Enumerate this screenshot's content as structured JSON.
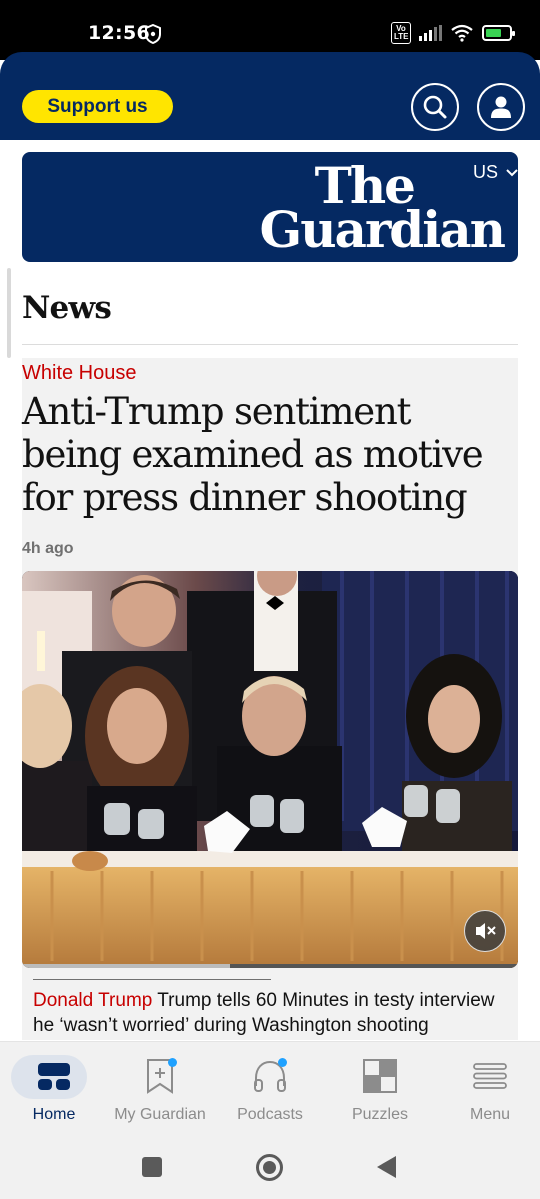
{
  "status_bar": {
    "time": "12:56",
    "volte_label": "Vo LTE",
    "battery_label": "6"
  },
  "header": {
    "support_label": "Support us",
    "search_icon": "search-icon",
    "profile_icon": "profile-icon"
  },
  "masthead": {
    "logo_line1": "The",
    "logo_line2": "Guardian",
    "edition": "US"
  },
  "section": {
    "title": "News"
  },
  "lead_story": {
    "kicker": "White House",
    "headline": "Anti-Trump sentiment being examined as motive for press dinner shooting",
    "timestamp": "4h ago",
    "video_progress_fraction": 0.42
  },
  "related_story": {
    "kicker": "Donald Trump",
    "headline": "Trump tells 60 Minutes in testy interview he ‘wasn’t worried’ during Washington shooting"
  },
  "bottom_nav": {
    "items": [
      {
        "label": "Home",
        "icon": "home-icon",
        "active": true
      },
      {
        "label": "My Guardian",
        "icon": "bookmark-add-icon",
        "badge": true
      },
      {
        "label": "Podcasts",
        "icon": "headphones-icon",
        "badge": true
      },
      {
        "label": "Puzzles",
        "icon": "crossword-icon"
      },
      {
        "label": "Menu",
        "icon": "menu-icon"
      }
    ]
  },
  "colors": {
    "brand_blue": "#052962",
    "support_yellow": "#ffe500",
    "kicker_red": "#c70000",
    "badge_blue": "#1fa1ff"
  }
}
